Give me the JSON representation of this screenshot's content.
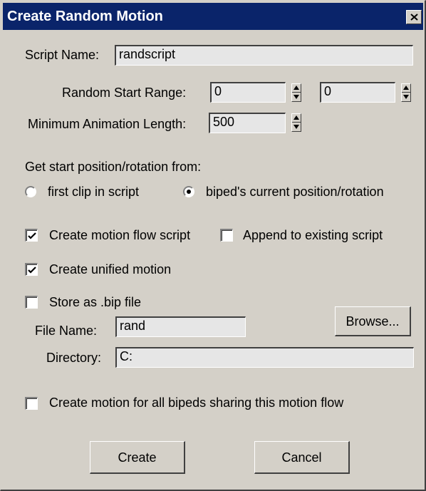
{
  "window": {
    "title": "Create Random Motion",
    "close_glyph": "×"
  },
  "script_name": {
    "label": "Script Name:",
    "value": "randscript"
  },
  "random_start_range": {
    "label": "Random Start Range:",
    "value_from": "0",
    "value_to": "0"
  },
  "min_anim_length": {
    "label": "Minimum Animation Length:",
    "value": "500"
  },
  "start_position": {
    "label": "Get start position/rotation from:",
    "options": [
      {
        "label": "first clip in script",
        "selected": false
      },
      {
        "label": "biped's current position/rotation",
        "selected": true
      }
    ]
  },
  "options": {
    "create_motion_flow_script": {
      "label": "Create motion flow script",
      "checked": true
    },
    "append_to_existing_script": {
      "label": "Append to existing script",
      "checked": false
    },
    "create_unified_motion": {
      "label": "Create unified motion",
      "checked": true
    },
    "store_as_bip": {
      "label": "Store as .bip file",
      "checked": false
    },
    "create_for_all_bipeds": {
      "label": "Create motion for all bipeds sharing this motion flow",
      "checked": false
    }
  },
  "file": {
    "file_name_label": "File Name:",
    "file_name_value": "rand",
    "directory_label": "Directory:",
    "directory_value": "C:",
    "browse_label": "Browse..."
  },
  "buttons": {
    "create_label": "Create",
    "cancel_label": "Cancel"
  },
  "icons": {
    "close": "close-icon",
    "spinner": "spinner-arrows-icon",
    "check": "checkmark-icon"
  },
  "colors": {
    "titlebar": "#0a246a",
    "dialog_bg": "#d4d0c8",
    "field_bg": "#e6e6e6"
  }
}
